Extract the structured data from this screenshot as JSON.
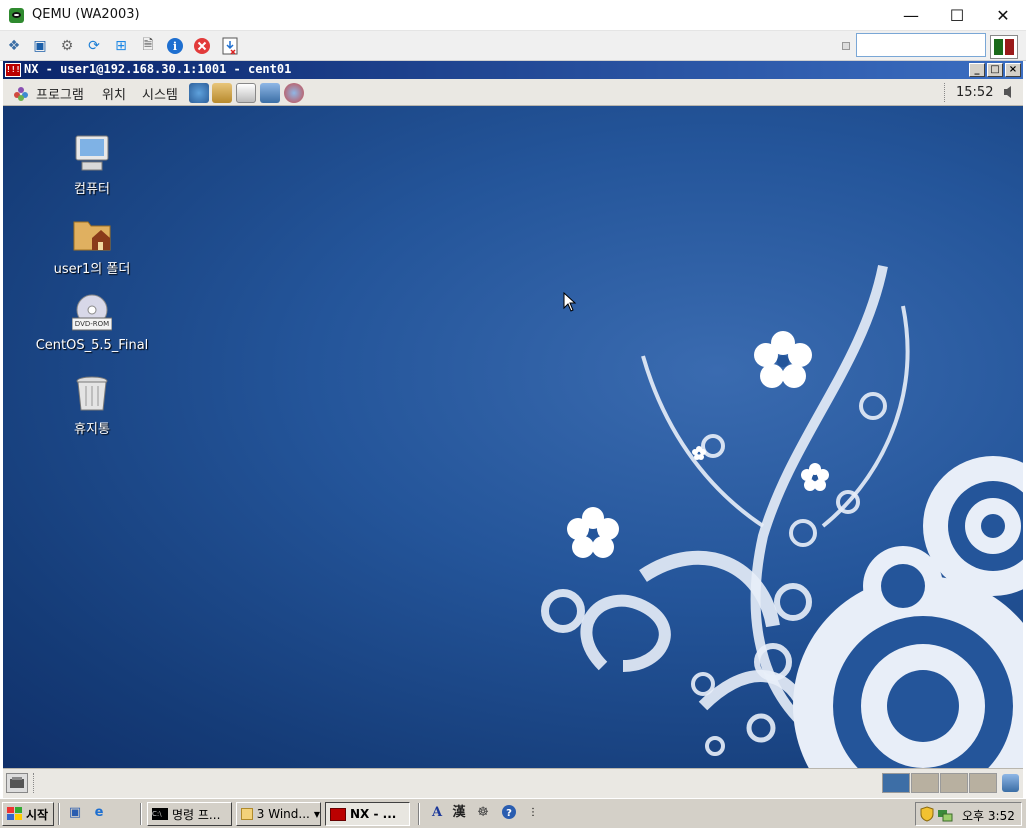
{
  "window": {
    "title": "QEMU (WA2003)"
  },
  "nx": {
    "title": "NX - user1@192.168.30.1:1001 - cent01",
    "logo": "!!!"
  },
  "gnome": {
    "menus": [
      "프로그램",
      "위치",
      "시스템"
    ],
    "clock": "15:52"
  },
  "desktop": {
    "icons": [
      {
        "label": "컴퓨터",
        "icon": "computer-icon"
      },
      {
        "label": "user1의 폴더",
        "icon": "home-folder-icon"
      },
      {
        "label": "CentOS_5.5_Final",
        "icon": "dvd-icon"
      },
      {
        "label": "휴지통",
        "icon": "trash-icon"
      }
    ],
    "dvd_badge": "DVD-ROM"
  },
  "taskbar": {
    "start": "시작",
    "tasks": [
      "명령 프...",
      "3 Wind...",
      "NX - ..."
    ],
    "ime": [
      "A",
      "漢"
    ],
    "clock": "오후 3:52"
  },
  "colors": {
    "nx_title": "#0a246a",
    "desktop": "#24559a",
    "panel": "#eae8e3"
  }
}
